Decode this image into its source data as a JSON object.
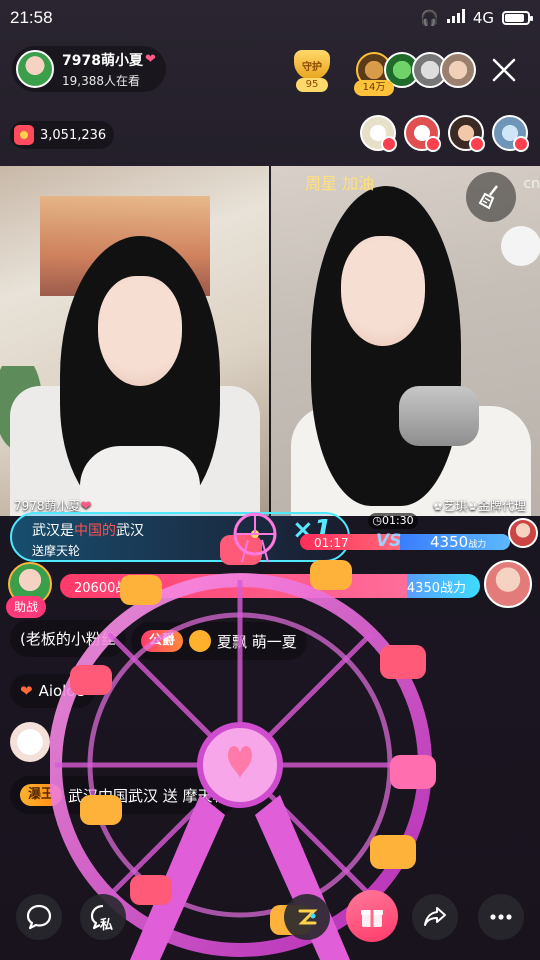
{
  "status_bar": {
    "time": "21:58",
    "network": "4G",
    "battery_level": 0.85
  },
  "host": {
    "name": "7978萌小夏",
    "viewers": "19,388人在看"
  },
  "guard": {
    "label": "守护",
    "count": "95"
  },
  "top_fans": {
    "rank_tag": "14万"
  },
  "coins": {
    "amount": "3,051,236"
  },
  "panes": {
    "right_caption": "周星 加油",
    "watermark": "cn",
    "left_name": "7978萌小夏",
    "right_name": "♚艺琪♚金牌代理"
  },
  "gift_notice": {
    "message_prefix": "武汉是",
    "message_highlight": "中国的",
    "message_suffix": "武汉",
    "sub": "送摩天轮",
    "combo": "×1"
  },
  "pk": {
    "timer": "01:30",
    "top_time": "01:17",
    "vs": "VS",
    "right_score": "4350",
    "right_score_unit": "战力",
    "left_power": "20600战力",
    "right_power": "4350战力",
    "left_ratio": 0.826,
    "assist_label": "助战"
  },
  "chat": {
    "row1": "(老板的小粉丝",
    "row2_tag": "公爵",
    "row2_text": "夏飘 萌一夏",
    "row3_name": "Aioloe",
    "row5_tag": "瀑王",
    "row5_text": "武汉中国武汉 送 摩天轮"
  },
  "bottom": {
    "private_label": "私"
  },
  "colors": {
    "accent_pink": "#ff3a6a",
    "accent_blue": "#3edcff",
    "gold": "#ffc23a"
  }
}
